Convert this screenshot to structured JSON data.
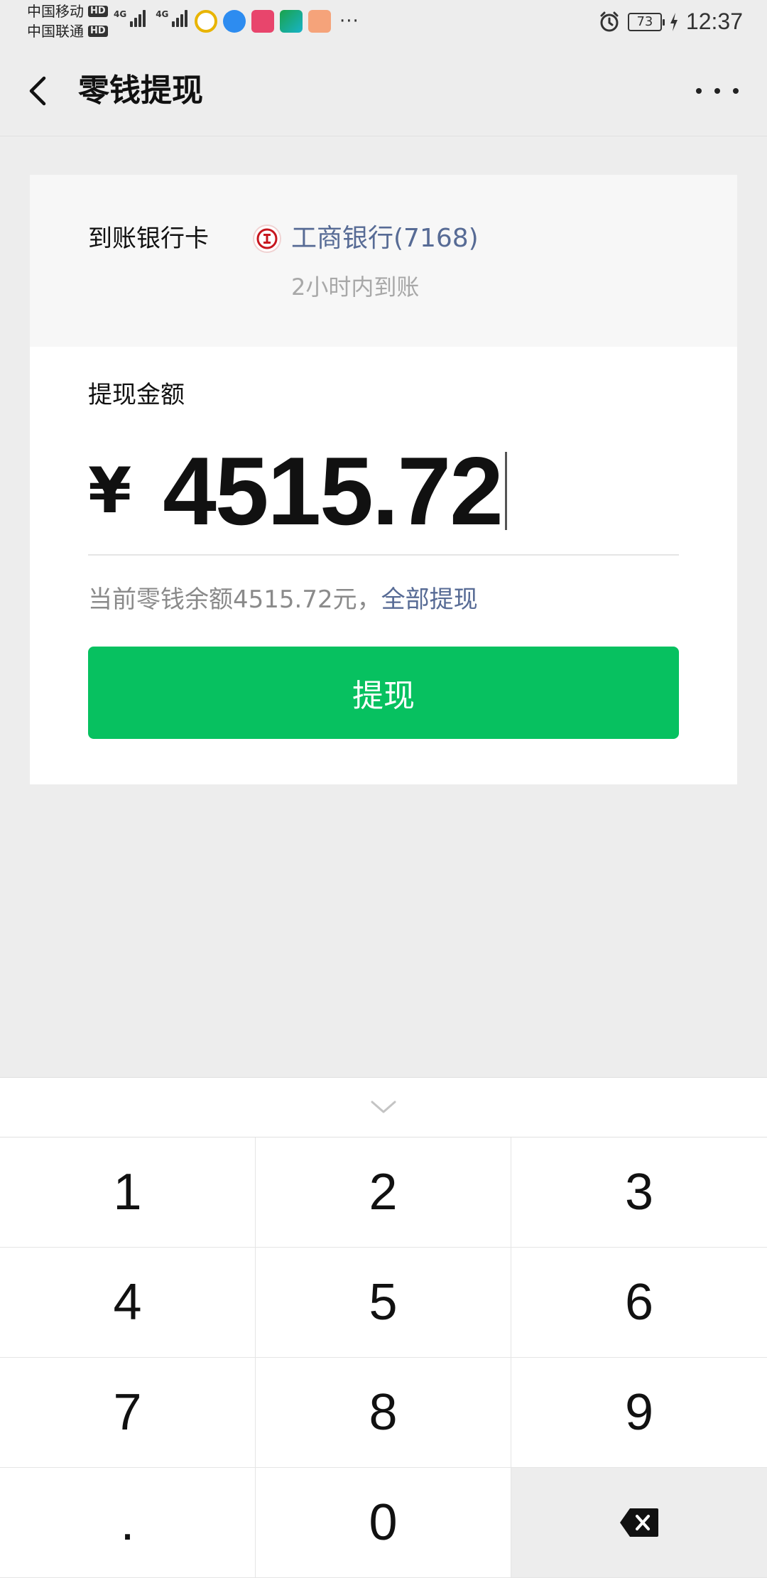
{
  "status_bar": {
    "carrier1": "中国移动",
    "carrier2": "中国联通",
    "hd": "HD",
    "net1": "4G",
    "net2": "4G",
    "more": "···",
    "battery": "73",
    "time": "12:37"
  },
  "nav": {
    "title": "零钱提现"
  },
  "card": {
    "bank_label": "到账银行卡",
    "bank_name": "工商银行(7168)",
    "arrival_note": "2小时内到账",
    "amount_label": "提现金额",
    "currency": "¥",
    "amount": "4515.72",
    "balance_prefix": "当前零钱余额4515.72元，",
    "withdraw_all": "全部提现",
    "withdraw_button": "提现"
  },
  "keyboard": {
    "keys": [
      "1",
      "2",
      "3",
      "4",
      "5",
      "6",
      "7",
      "8",
      "9",
      ".",
      "0"
    ]
  },
  "colors": {
    "accent_green": "#07c160",
    "link_blue": "#576b95",
    "background": "#ededed"
  }
}
